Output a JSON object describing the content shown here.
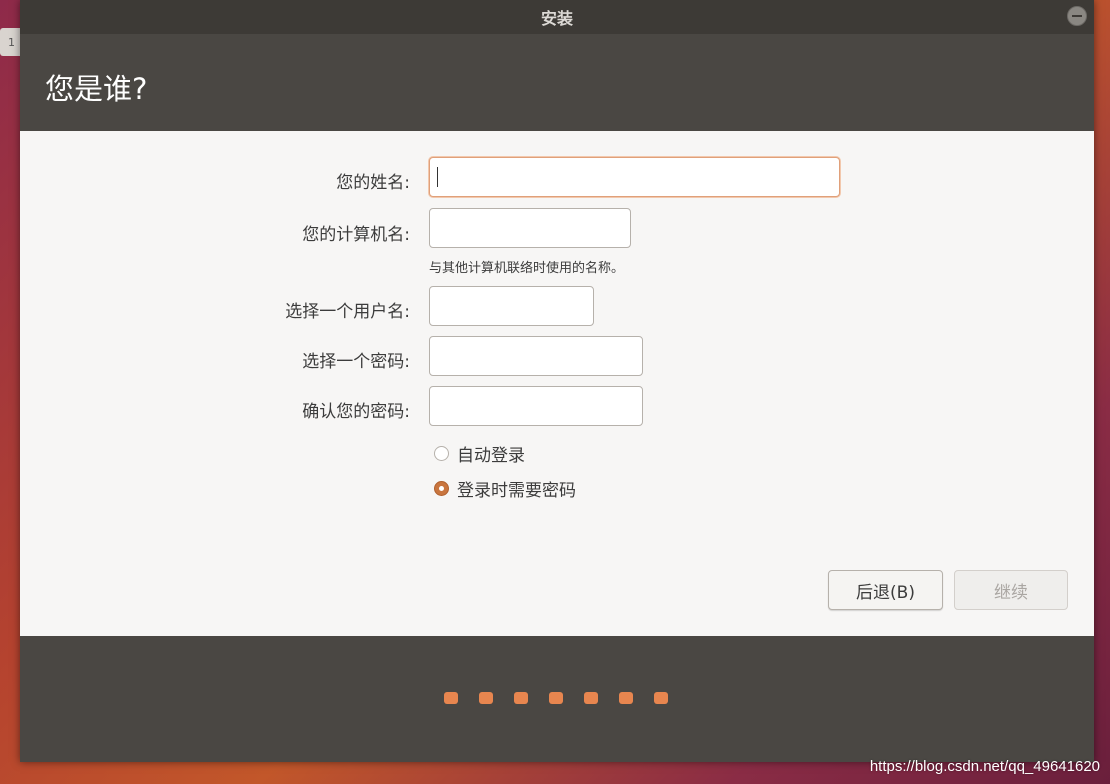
{
  "desktop": {
    "tab_text": "1"
  },
  "window": {
    "title": "安装",
    "minimize_icon": "minimize-icon"
  },
  "header": {
    "page_title": "您是谁?"
  },
  "form": {
    "name_label": "您的姓名:",
    "name_value": "",
    "computer_label": "您的计算机名:",
    "computer_value": "",
    "computer_hint": "与其他计算机联络时使用的名称。",
    "username_label": "选择一个用户名:",
    "username_value": "",
    "password_label": "选择一个密码:",
    "password_value": "",
    "confirm_label": "确认您的密码:",
    "confirm_value": "",
    "login_options": [
      {
        "label": "自动登录",
        "checked": false
      },
      {
        "label": "登录时需要密码",
        "checked": true
      }
    ]
  },
  "buttons": {
    "back_label": "后退(B)",
    "continue_label": "继续"
  },
  "progress": {
    "step_count": 7,
    "color": "#e8864f"
  },
  "watermark": "https://blog.csdn.net/qq_49641620",
  "colors": {
    "accent": "#c9753e",
    "header_bg": "#4a4743",
    "content_bg": "#f7f6f5"
  }
}
